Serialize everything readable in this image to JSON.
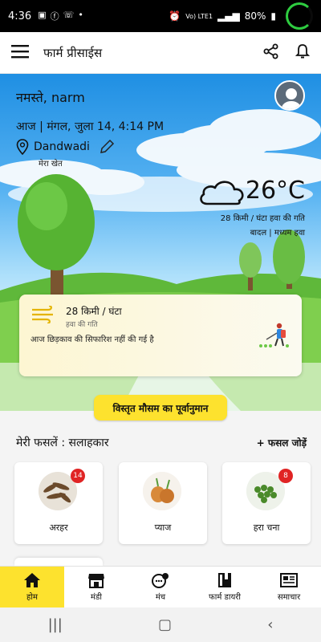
{
  "status_bar": {
    "time": "4:36",
    "signal_text": "Vo) LTE1",
    "battery": "80%"
  },
  "app_bar": {
    "title": "फार्म प्रीसाईस"
  },
  "hero": {
    "greeting": "नमस्ते, narm",
    "date": "आज | मंगल, जुला 14, 4:14 PM",
    "location": "Dandwadi",
    "location_label": "मेरा खेत",
    "temperature": "26°C",
    "wind_speed": "28 किमी / घंटा हवा की गति",
    "condition": "बादल | मध्यम हवा"
  },
  "spray_card": {
    "speed": "28 किमी / घंटा",
    "speed_label": "हवा की गति",
    "advice": "आज छिड़काव की सिफारिश नहीं की गई है"
  },
  "forecast_button": "विस्तृत मौसम का पूर्वानुमान",
  "crops": {
    "heading": "मेरी फसलें : सलाहकार",
    "add_label": "+ फसल जोड़ें",
    "items": [
      {
        "name": "अरहर",
        "badge": "14"
      },
      {
        "name": "प्याज",
        "badge": ""
      },
      {
        "name": "हरा चना",
        "badge": "8"
      }
    ]
  },
  "bottom_nav": [
    {
      "label": "होम",
      "icon": "home-icon",
      "active": true
    },
    {
      "label": "मंडी",
      "icon": "store-icon",
      "active": false
    },
    {
      "label": "मंच",
      "icon": "community-icon",
      "active": false
    },
    {
      "label": "फार्म डायरी",
      "icon": "diary-icon",
      "active": false
    },
    {
      "label": "समाचार",
      "icon": "news-icon",
      "active": false
    }
  ],
  "colors": {
    "accent": "#fde22e",
    "badge": "#e02424",
    "sky": "#1f8fe3"
  }
}
